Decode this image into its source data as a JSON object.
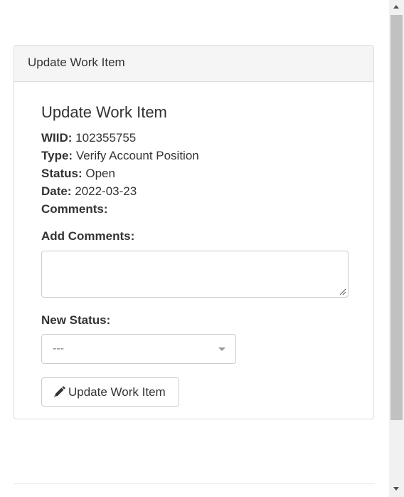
{
  "panel": {
    "heading": "Update Work Item",
    "title": "Update Work Item"
  },
  "details": {
    "wiid_label": "WIID:",
    "wiid_value": "102355755",
    "type_label": "Type:",
    "type_value": "Verify Account Position",
    "status_label": "Status:",
    "status_value": "Open",
    "date_label": "Date:",
    "date_value": "2022-03-23",
    "comments_label": "Comments:"
  },
  "form": {
    "add_comments_label": "Add Comments:",
    "add_comments_value": "",
    "new_status_label": "New Status:",
    "new_status_selected": "---",
    "submit_label": "Update Work Item",
    "submit_icon": "pencil-icon"
  },
  "colors": {
    "panel_heading_bg": "#f5f5f5",
    "border": "#dddddd",
    "text": "#333333",
    "placeholder": "#777777"
  }
}
